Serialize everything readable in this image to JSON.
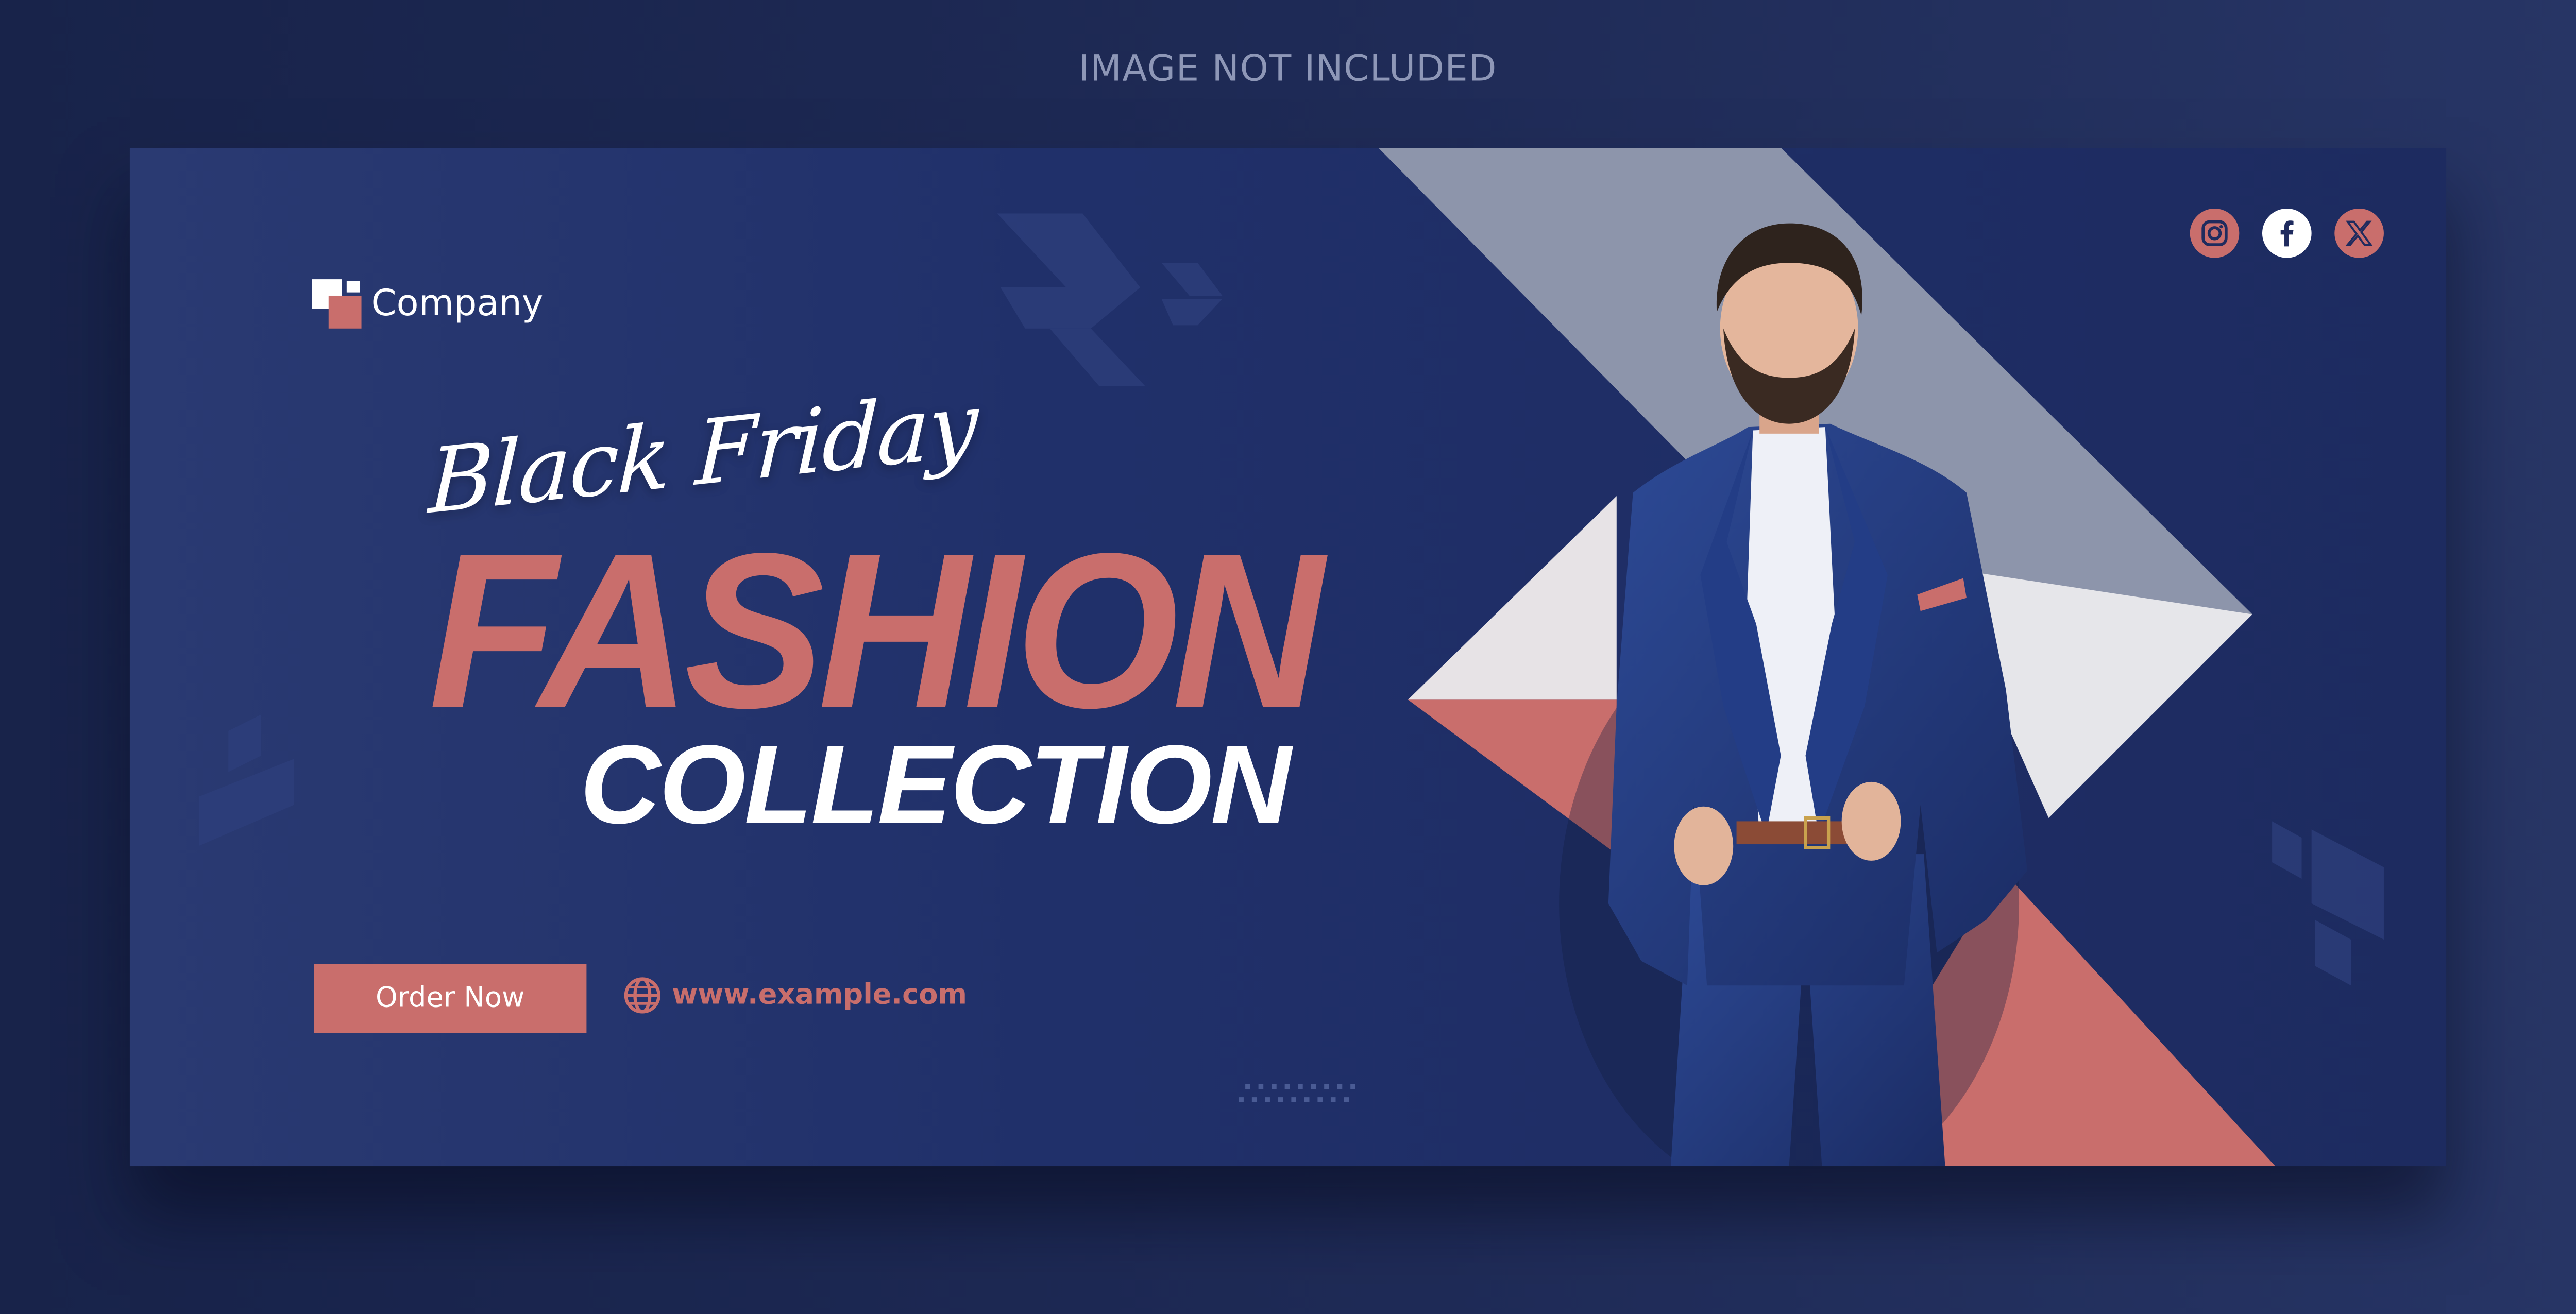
{
  "top_note": "IMAGE NOT INCLUDED",
  "brand": {
    "name": "Company",
    "logo_icon": "stacked-squares-logo"
  },
  "headline": {
    "script": "Black Friday",
    "main": "FASHION",
    "sub": "COLLECTION"
  },
  "cta": {
    "label": "Order Now"
  },
  "website": {
    "url": "www.example.com",
    "icon": "globe-icon"
  },
  "socials": [
    {
      "name": "instagram-icon"
    },
    {
      "name": "facebook-icon"
    },
    {
      "name": "x-icon"
    }
  ],
  "colors": {
    "navy": "#1f2b5e",
    "accent": "#c96e6c",
    "white": "#ffffff",
    "grey": "#8d95ab"
  }
}
